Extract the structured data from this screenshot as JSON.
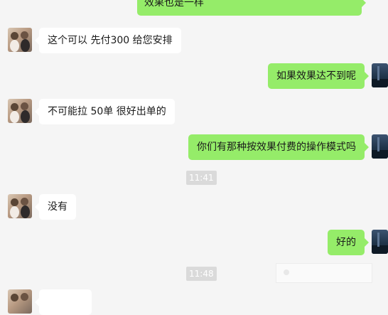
{
  "messages": [
    {
      "side": "right",
      "text": "效果也是一样"
    },
    {
      "side": "left",
      "text": "这个可以 先付300 给您安排"
    },
    {
      "side": "right",
      "text": "如果效果达不到呢"
    },
    {
      "side": "left",
      "text": "不可能拉 50单 很好出单的"
    },
    {
      "side": "right",
      "text": "你们有那种按效果付费的操作模式吗"
    },
    {
      "side": "left",
      "text": "没有"
    },
    {
      "side": "right",
      "text": "好的"
    }
  ],
  "timestamps": [
    "11:41",
    "11:48"
  ]
}
